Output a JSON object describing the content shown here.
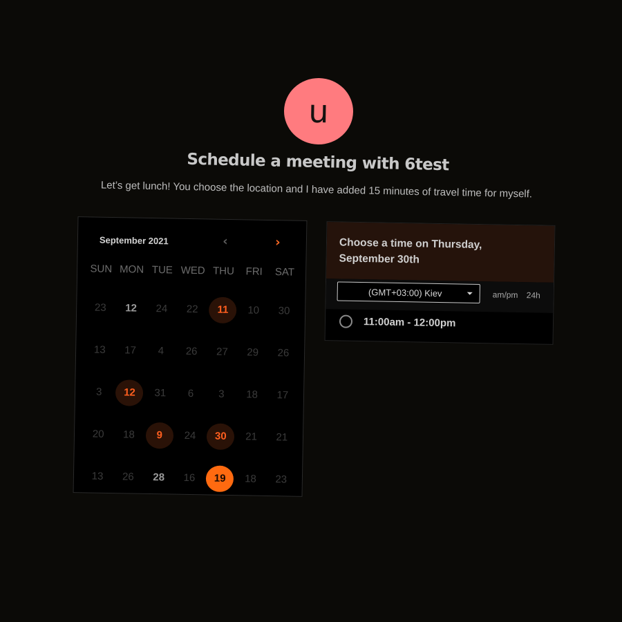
{
  "host": {
    "avatar_letter": "u",
    "avatar_color": "#ff7b7f"
  },
  "header": {
    "title": "Schedule a meeting with 6test",
    "subtitle": "Let’s get lunch! You choose the location and I have added 15 minutes of travel time for myself."
  },
  "calendar": {
    "month_label": "September 2021",
    "prev_icon": "chevron-left-icon",
    "next_icon": "chevron-right-icon",
    "weekdays": [
      "SUN",
      "MON",
      "TUE",
      "WED",
      "THU",
      "FRI",
      "SAT"
    ],
    "days": [
      {
        "label": "23",
        "state": "muted"
      },
      {
        "label": "12",
        "state": "bold"
      },
      {
        "label": "24",
        "state": "muted"
      },
      {
        "label": "22",
        "state": "muted"
      },
      {
        "label": "11",
        "state": "available"
      },
      {
        "label": "10",
        "state": "muted"
      },
      {
        "label": "30",
        "state": "muted"
      },
      {
        "label": "13",
        "state": "muted"
      },
      {
        "label": "17",
        "state": "muted"
      },
      {
        "label": "4",
        "state": "muted"
      },
      {
        "label": "26",
        "state": "muted"
      },
      {
        "label": "27",
        "state": "muted"
      },
      {
        "label": "29",
        "state": "muted"
      },
      {
        "label": "26",
        "state": "muted"
      },
      {
        "label": "3",
        "state": "muted"
      },
      {
        "label": "12",
        "state": "available"
      },
      {
        "label": "31",
        "state": "muted"
      },
      {
        "label": "6",
        "state": "muted"
      },
      {
        "label": "3",
        "state": "muted"
      },
      {
        "label": "18",
        "state": "muted"
      },
      {
        "label": "17",
        "state": "muted"
      },
      {
        "label": "20",
        "state": "muted"
      },
      {
        "label": "18",
        "state": "muted"
      },
      {
        "label": "9",
        "state": "available"
      },
      {
        "label": "24",
        "state": "muted"
      },
      {
        "label": "30",
        "state": "available"
      },
      {
        "label": "21",
        "state": "muted"
      },
      {
        "label": "21",
        "state": "muted"
      },
      {
        "label": "13",
        "state": "muted"
      },
      {
        "label": "26",
        "state": "muted"
      },
      {
        "label": "28",
        "state": "bold"
      },
      {
        "label": "16",
        "state": "muted"
      },
      {
        "label": "19",
        "state": "selected"
      },
      {
        "label": "18",
        "state": "muted"
      },
      {
        "label": "23",
        "state": "muted"
      }
    ],
    "accent_color": "#ff6a10"
  },
  "time_panel": {
    "title": "Choose a time on Thursday, September 30th",
    "timezone": "(GMT+03:00) Kiev",
    "format_ampm": "am/pm",
    "format_24h": "24h",
    "slots": [
      {
        "label": "11:00am - 12:00pm"
      }
    ]
  }
}
